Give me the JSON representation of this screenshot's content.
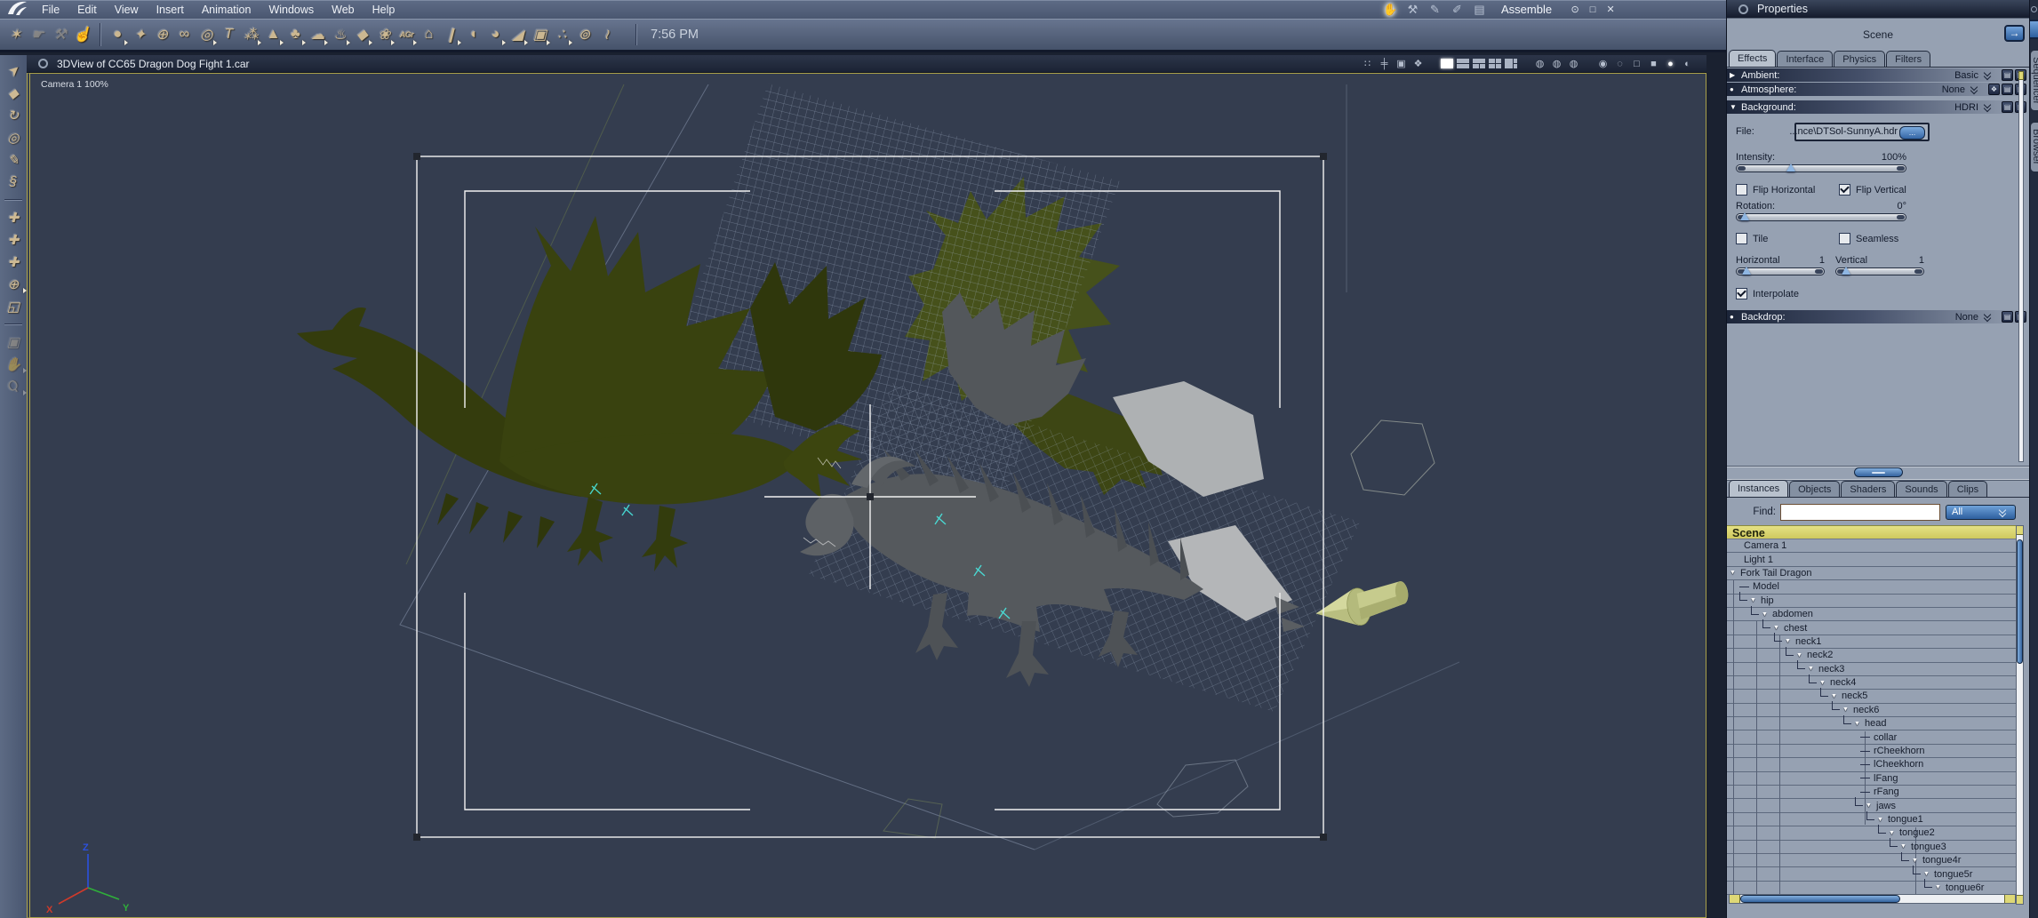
{
  "window": {
    "mode_label": "Assemble",
    "clock": "7:56 PM",
    "controls": {
      "eye": "⊙",
      "maximize": "□",
      "close": "✕"
    }
  },
  "menu_bar": {
    "items": [
      "File",
      "Edit",
      "View",
      "Insert",
      "Animation",
      "Windows",
      "Web",
      "Help"
    ]
  },
  "mode_icons": [
    {
      "name": "assemble-hand-icon",
      "glyph": "✋"
    },
    {
      "name": "model-wrench-icon",
      "glyph": "⚒"
    },
    {
      "name": "texture-pen-icon",
      "glyph": "✎"
    },
    {
      "name": "paint-brush-icon",
      "glyph": "✐"
    },
    {
      "name": "render-film-icon",
      "glyph": "▤"
    }
  ],
  "toolbar": {
    "icons": [
      {
        "name": "spline-edit-icon",
        "glyph": "✶"
      },
      {
        "name": "pan-hand-icon",
        "glyph": "☛"
      },
      {
        "name": "adjust-wrench-icon",
        "glyph": "⚒"
      },
      {
        "name": "push-finger-icon",
        "glyph": "☝"
      },
      {
        "name": "sphere-primitive-icon",
        "glyph": "●"
      },
      {
        "name": "vertex-object-icon",
        "glyph": "✦"
      },
      {
        "name": "spline-object-icon",
        "glyph": "⊕"
      },
      {
        "name": "metaball-icon",
        "glyph": "∞"
      },
      {
        "name": "formula-icon",
        "glyph": "◎"
      },
      {
        "name": "text-object-icon",
        "glyph": "T"
      },
      {
        "name": "particles-icon",
        "glyph": "⁂"
      },
      {
        "name": "terrain-icon",
        "glyph": "▲"
      },
      {
        "name": "tree-icon",
        "glyph": "♣"
      },
      {
        "name": "cloud-icon",
        "glyph": "☁"
      },
      {
        "name": "fire-icon",
        "glyph": "♨"
      },
      {
        "name": "rock-icon",
        "glyph": "◆"
      },
      {
        "name": "plant-icon",
        "glyph": "❀"
      },
      {
        "name": "grass-icon",
        "glyph": "AGr"
      },
      {
        "name": "scene-room-icon",
        "glyph": "⌂"
      },
      {
        "name": "capsule-icon",
        "glyph": "❙"
      },
      {
        "name": "mitt-icon",
        "glyph": "◖"
      },
      {
        "name": "blob-icon",
        "glyph": "◕"
      },
      {
        "name": "spotlight-icon",
        "glyph": "◢"
      },
      {
        "name": "movie-camera-icon",
        "glyph": "▣"
      },
      {
        "name": "crowd-icon",
        "glyph": "∴"
      },
      {
        "name": "target-icon",
        "glyph": "⊚"
      },
      {
        "name": "bone-icon",
        "glyph": "≀"
      }
    ]
  },
  "left_toolbar": {
    "icons": [
      {
        "name": "select-arrow-icon",
        "glyph": "➤"
      },
      {
        "name": "scale-tool-icon",
        "glyph": "◆"
      },
      {
        "name": "rotate-tool-icon",
        "glyph": "↻"
      },
      {
        "name": "ring-tool-icon",
        "glyph": "◎"
      },
      {
        "name": "eyedropper-icon",
        "glyph": "✎"
      },
      {
        "name": "link-tool-icon",
        "glyph": "§"
      },
      {
        "name": "move-xy-icon",
        "glyph": "✚"
      },
      {
        "name": "move-3d-icon",
        "glyph": "✚"
      },
      {
        "name": "move-screen-icon",
        "glyph": "✚"
      },
      {
        "name": "sphere-pan-icon",
        "glyph": "⊕"
      },
      {
        "name": "working-box-icon",
        "glyph": "◱"
      },
      {
        "name": "render-camera-icon",
        "glyph": "▣"
      },
      {
        "name": "hand-pan-icon",
        "glyph": "✋"
      },
      {
        "name": "zoom-tool-icon",
        "glyph": "Ϙ"
      }
    ]
  },
  "viewport": {
    "title": "3DView of CC65 Dragon Dog Fight 1.car",
    "camera_label": "Camera 1 100%",
    "axis": {
      "x": "X",
      "y": "Y",
      "z": "Z"
    },
    "icons": [
      {
        "name": "preview-dots-icon",
        "glyph": "∷"
      },
      {
        "name": "hierarchy-icon",
        "glyph": "╪"
      },
      {
        "name": "camera-toggle-icon",
        "glyph": "▣"
      },
      {
        "name": "reference-box-icon",
        "glyph": "❖"
      },
      {
        "name": "draft-bounding-icon",
        "glyph": "◍"
      },
      {
        "name": "draft-wireframe-icon",
        "glyph": "◍"
      },
      {
        "name": "draft-lit-wire-icon",
        "glyph": "◍"
      },
      {
        "name": "motion-mode-icon",
        "glyph": "◉"
      },
      {
        "name": "subdivision-icon",
        "glyph": "◌"
      },
      {
        "name": "wire-cube-icon",
        "glyph": "□"
      },
      {
        "name": "flat-cube-icon",
        "glyph": "■"
      },
      {
        "name": "smooth-sphere-icon",
        "glyph": "●"
      },
      {
        "name": "texture-sphere-icon",
        "glyph": "◐"
      }
    ]
  },
  "properties": {
    "title": "Properties",
    "scene_label": "Scene",
    "jump_arrow": "→",
    "tabs": [
      "Effects",
      "Interface",
      "Physics",
      "Filters"
    ],
    "active_tab": "Effects",
    "headers": {
      "ambient": {
        "glyph": "▶",
        "label": "Ambient:",
        "value": "Basic"
      },
      "atmosphere": {
        "glyph": "●",
        "label": "Atmosphere:",
        "value": "None"
      },
      "background": {
        "glyph": "▼",
        "label": "Background:",
        "value": "HDRI"
      },
      "backdrop": {
        "glyph": "●",
        "label": "Backdrop:",
        "value": "None"
      }
    },
    "background": {
      "file_label": "File:",
      "file_value": "...nce\\DTSol-SunnyA.hdr",
      "browse_label": "...",
      "intensity_label": "Intensity:",
      "intensity_value": "100%",
      "flip_horizontal": "Flip Horizontal",
      "flip_vertical": "Flip Vertical",
      "rotation_label": "Rotation:",
      "rotation_value": "0°",
      "tile": "Tile",
      "seamless": "Seamless",
      "horizontal_label": "Horizontal",
      "horizontal_value": "1",
      "vertical_label": "Vertical",
      "vertical_value": "1",
      "interpolate": "Interpolate"
    }
  },
  "browser_panel": {
    "tabs": [
      "Instances",
      "Objects",
      "Shaders",
      "Sounds",
      "Clips"
    ],
    "active_tab": "Instances",
    "find_label": "Find:",
    "find_value": "",
    "filter_value": "All",
    "scene_header": "Scene",
    "tree": [
      {
        "label": "Camera 1",
        "depth": 1,
        "expandable": false
      },
      {
        "label": "Light 1",
        "depth": 1,
        "expandable": false
      },
      {
        "label": "Fork Tail Dragon",
        "depth": 0,
        "expandable": true
      },
      {
        "label": "Model",
        "depth": 1,
        "expandable": false
      },
      {
        "label": "hip",
        "depth": 1,
        "expandable": true
      },
      {
        "label": "abdomen",
        "depth": 2,
        "expandable": true
      },
      {
        "label": "chest",
        "depth": 3,
        "expandable": true
      },
      {
        "label": "neck1",
        "depth": 4,
        "expandable": true
      },
      {
        "label": "neck2",
        "depth": 5,
        "expandable": true
      },
      {
        "label": "neck3",
        "depth": 6,
        "expandable": true
      },
      {
        "label": "neck4",
        "depth": 7,
        "expandable": true
      },
      {
        "label": "neck5",
        "depth": 8,
        "expandable": true
      },
      {
        "label": "neck6",
        "depth": 9,
        "expandable": true
      },
      {
        "label": "head",
        "depth": 10,
        "expandable": true
      },
      {
        "label": "collar",
        "depth": 11,
        "expandable": false
      },
      {
        "label": "rCheekhorn",
        "depth": 11,
        "expandable": false
      },
      {
        "label": "lCheekhorn",
        "depth": 11,
        "expandable": false
      },
      {
        "label": "lFang",
        "depth": 11,
        "expandable": false
      },
      {
        "label": "rFang",
        "depth": 11,
        "expandable": false
      },
      {
        "label": "jaws",
        "depth": 11,
        "expandable": true
      },
      {
        "label": "tongue1",
        "depth": 12,
        "expandable": true
      },
      {
        "label": "tongue2",
        "depth": 13,
        "expandable": true
      },
      {
        "label": "tongue3",
        "depth": 14,
        "expandable": true
      },
      {
        "label": "tongue4r",
        "depth": 15,
        "expandable": true
      },
      {
        "label": "tongue5r",
        "depth": 16,
        "expandable": true
      },
      {
        "label": "tongue6r",
        "depth": 17,
        "expandable": true
      }
    ]
  },
  "side_tabs": {
    "sequencer": "Sequencer",
    "browser": "Browser"
  },
  "glyphs": {
    "tree_expander": "▼"
  },
  "colors": {
    "accent_blue": "#4b86c8",
    "view_border_yellow": "#b0a64c",
    "tree_header_yellow": "#d8d36f",
    "viewport_bg": "#343d4f",
    "panel_bg": "#96a1b2",
    "dragon_olive": "#39420f",
    "dragon_gray": "#55595d",
    "light_arrow_green": "#c6cb8d"
  }
}
